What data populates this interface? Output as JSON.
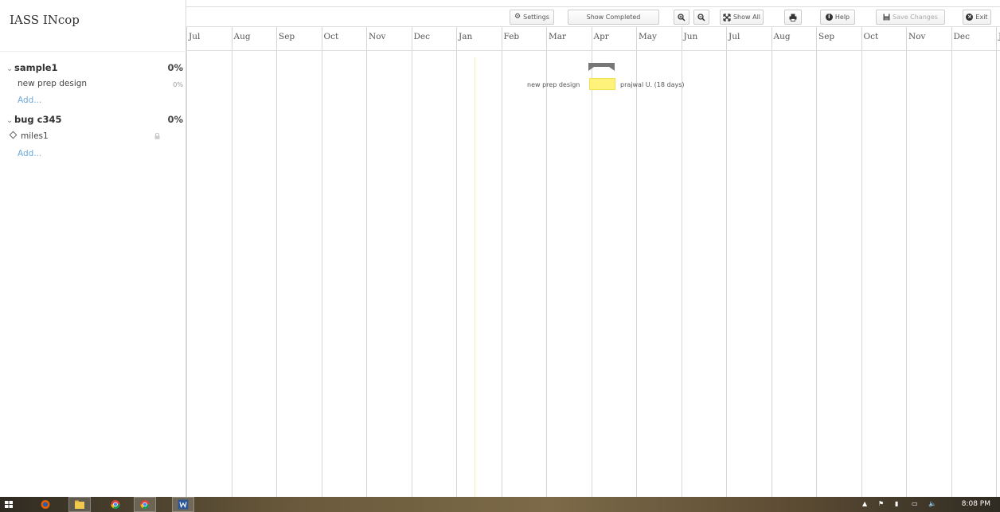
{
  "app": {
    "title": "IASS INcop"
  },
  "toolbar": {
    "settings_label": "Settings",
    "show_completed_label": "Show Completed",
    "show_all_label": "Show All",
    "help_label": "Help",
    "save_changes_label": "Save Changes",
    "exit_label": "Exit"
  },
  "timeline": {
    "months": [
      "Jul",
      "Aug",
      "Sep",
      "Oct",
      "Nov",
      "Dec",
      "Jan",
      "Feb",
      "Mar",
      "Apr",
      "May",
      "Jun",
      "Jul",
      "Aug",
      "Sep",
      "Oct",
      "Nov",
      "Dec",
      "J"
    ]
  },
  "projects": [
    {
      "name": "sample1",
      "percent": "0%",
      "tasks": [
        {
          "name": "new prep design",
          "percent": "0%"
        }
      ],
      "add_label": "Add..."
    },
    {
      "name": "bug c345",
      "percent": "0%",
      "milestones": [
        {
          "name": "miles1"
        }
      ],
      "add_label": "Add..."
    }
  ],
  "gantt": {
    "bar_label": "new prep design",
    "bar_assignee": "prajwal U. (18 days)"
  },
  "colors": {
    "bar_fill": "#fff27a",
    "summary_fill": "#777777",
    "link": "#6ea8d8",
    "taskbar": "#6b5a3c"
  },
  "taskbar": {
    "time": "8:08 PM"
  }
}
